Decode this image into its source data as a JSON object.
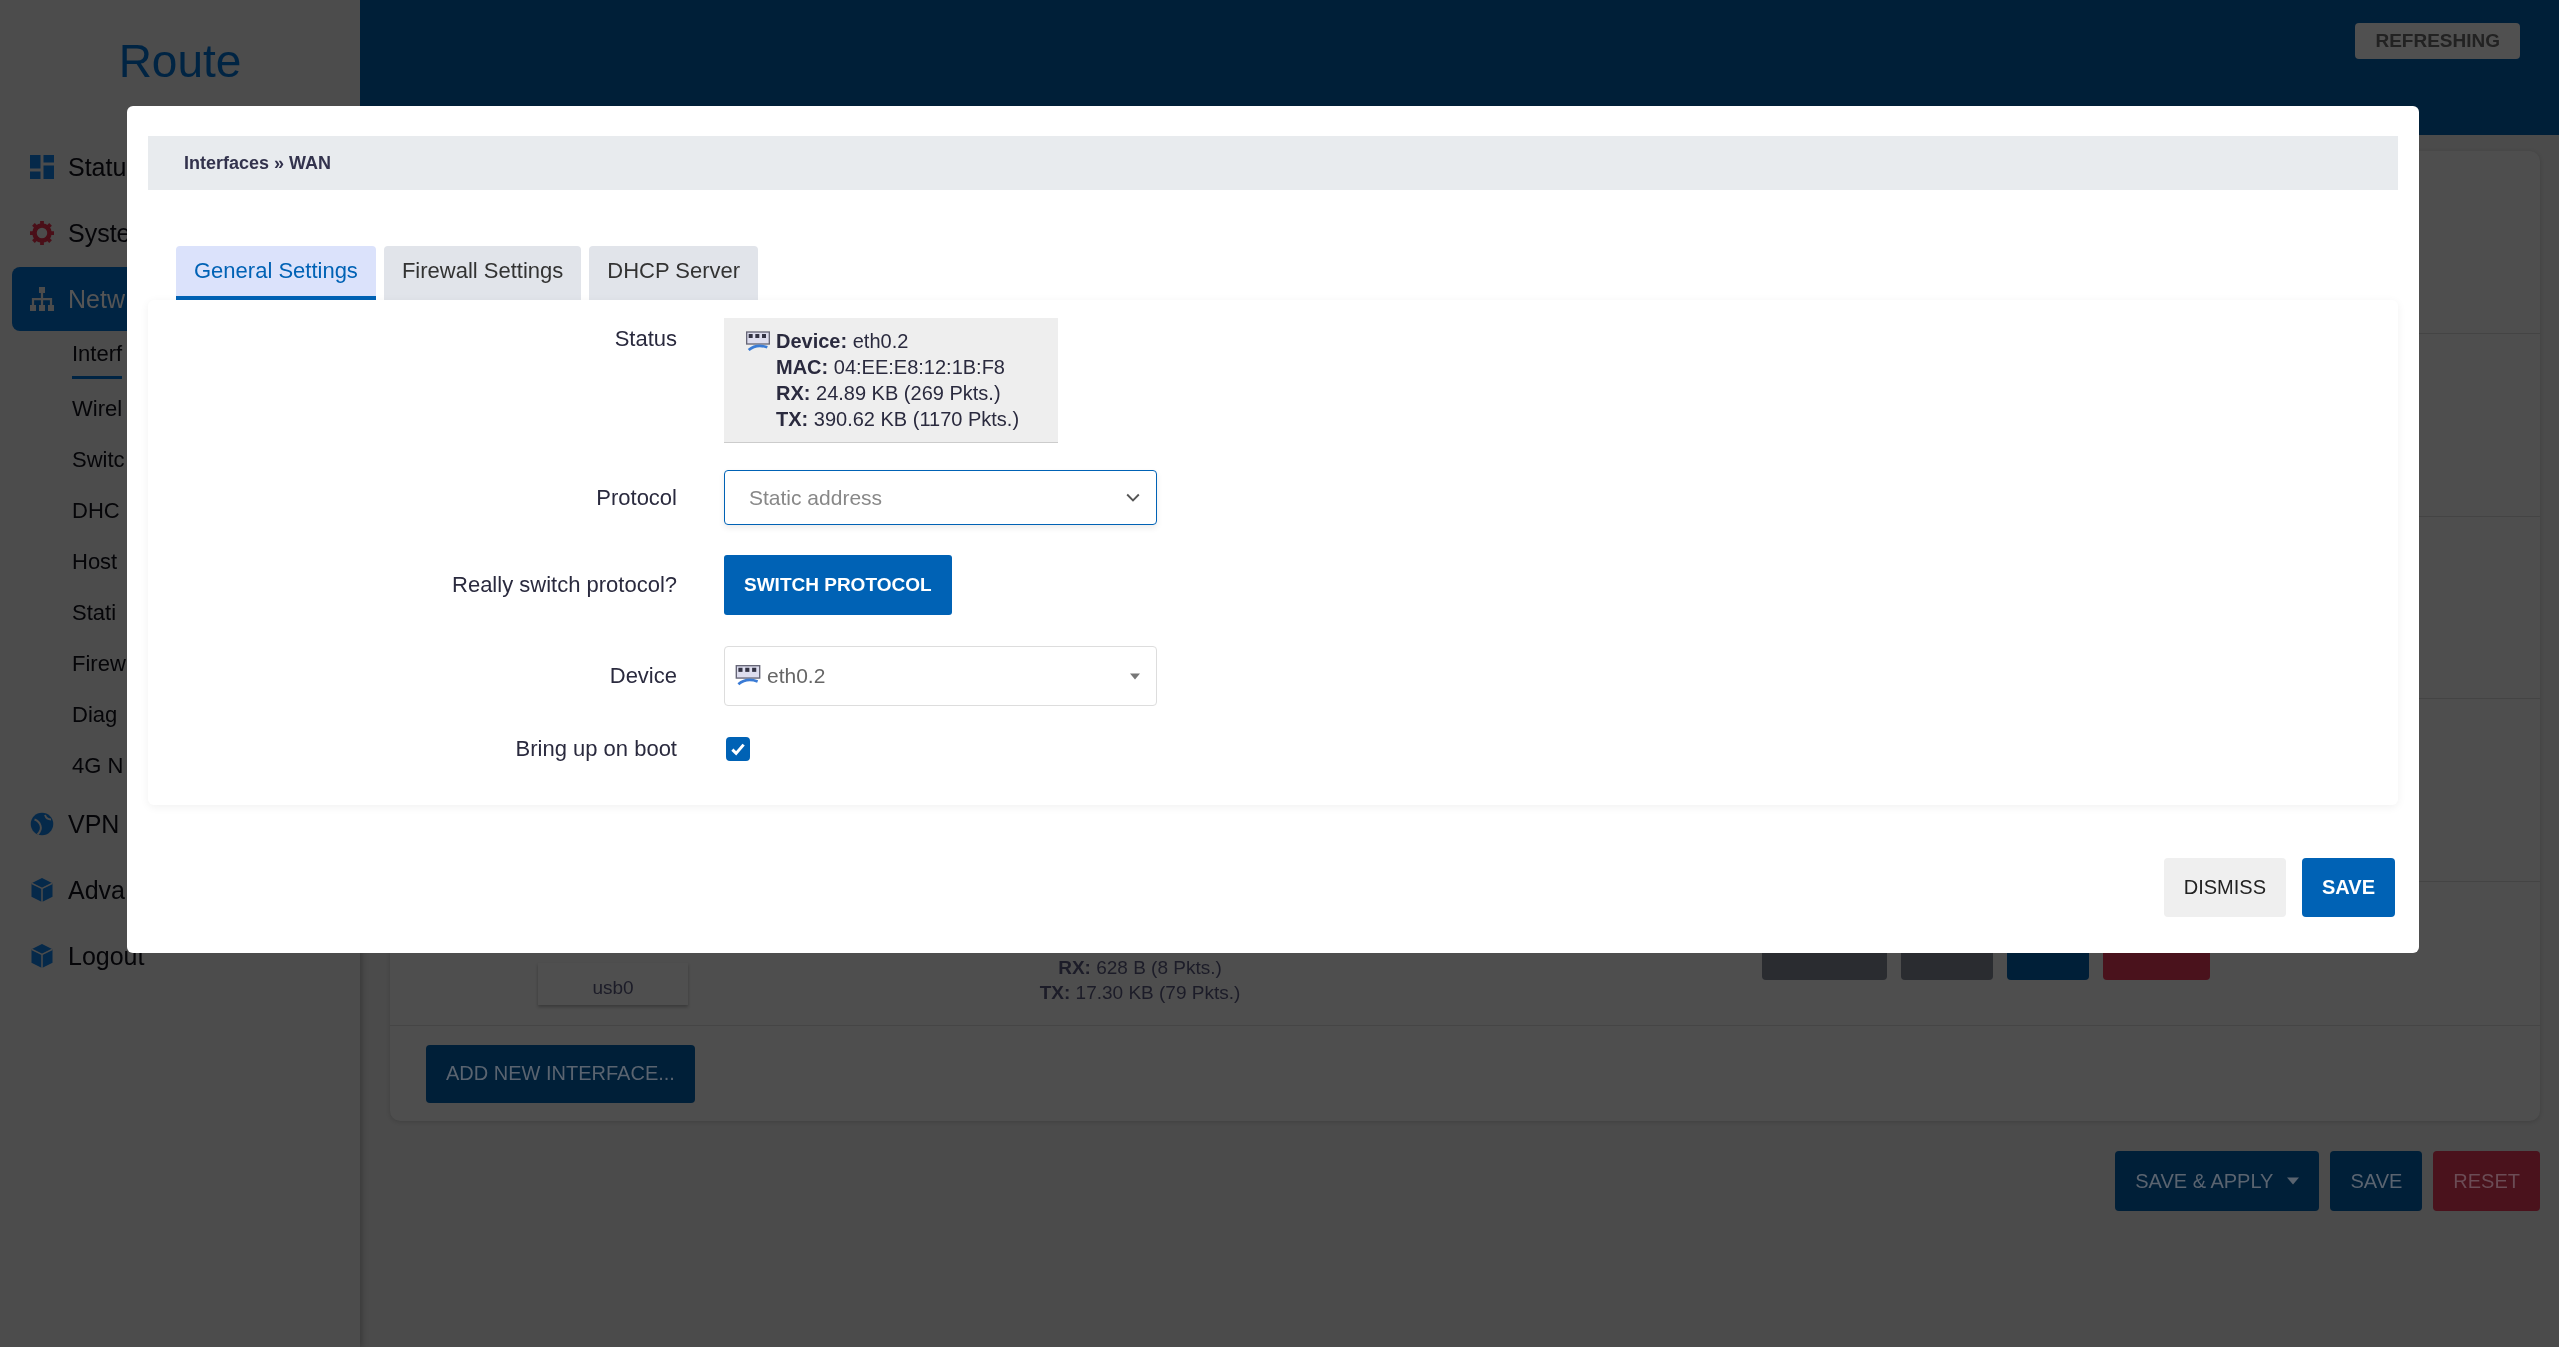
{
  "header": {
    "logo": "Route",
    "status_badge": "REFRESHING"
  },
  "sidebar": {
    "items": [
      {
        "label": "Statu",
        "kind": "grid",
        "selected": false
      },
      {
        "label": "Syste",
        "kind": "gear",
        "selected": false
      },
      {
        "label": "Netw",
        "kind": "tree",
        "selected": true,
        "children": [
          {
            "label": "Interf",
            "selected": true
          },
          {
            "label": "Wirel",
            "selected": false
          },
          {
            "label": "Switc",
            "selected": false
          },
          {
            "label": "DHC",
            "selected": false
          },
          {
            "label": "Host",
            "selected": false
          },
          {
            "label": "Stati",
            "selected": false
          },
          {
            "label": "Firew",
            "selected": false
          },
          {
            "label": "Diag",
            "selected": false
          },
          {
            "label": "4G N",
            "selected": false
          }
        ]
      },
      {
        "label": "VPN",
        "kind": "globe",
        "selected": false
      },
      {
        "label": "Adva",
        "kind": "cube",
        "selected": false
      },
      {
        "label": "Logout",
        "kind": "cube",
        "selected": false
      }
    ]
  },
  "interfaces": {
    "row": {
      "device": "usb0",
      "rx": "**RX:** 628 B (8 Pkts.)",
      "tx": "**TX:** 17.30 KB (79 Pkts.)"
    },
    "add_button": "ADD NEW INTERFACE..."
  },
  "footer_buttons": [
    {
      "label": "SAVE & APPLY",
      "kind": "primary",
      "dropdown": true
    },
    {
      "label": "SAVE",
      "kind": "primary",
      "dropdown": false
    },
    {
      "label": "RESET",
      "kind": "danger",
      "dropdown": false
    }
  ],
  "modal": {
    "breadcrumb": "Interfaces » WAN",
    "tabs": [
      {
        "label": "General Settings",
        "selected": true
      },
      {
        "label": "Firewall Settings",
        "selected": false
      },
      {
        "label": "DHCP Server",
        "selected": false
      }
    ],
    "fields": [
      {
        "kind": "status",
        "label": "Status",
        "lines": [
          "**Device:** eth0.2",
          "**MAC:** 04:EE:E8:12:1B:F8",
          "**RX:** 24.89 KB (269 Pkts.)",
          "**TX:** 390.62 KB (1170 Pkts.)"
        ]
      },
      {
        "kind": "select",
        "label": "Protocol",
        "value": "Static address"
      },
      {
        "kind": "button",
        "label": "Really switch protocol?",
        "button": "SWITCH PROTOCOL"
      },
      {
        "kind": "device",
        "label": "Device",
        "value": "eth0.2"
      },
      {
        "kind": "checkbox",
        "label": "Bring up on boot",
        "checked": true
      }
    ],
    "buttons": [
      {
        "label": "DISMISS",
        "kind": "secondary"
      },
      {
        "label": "SAVE",
        "kind": "primary"
      }
    ]
  }
}
